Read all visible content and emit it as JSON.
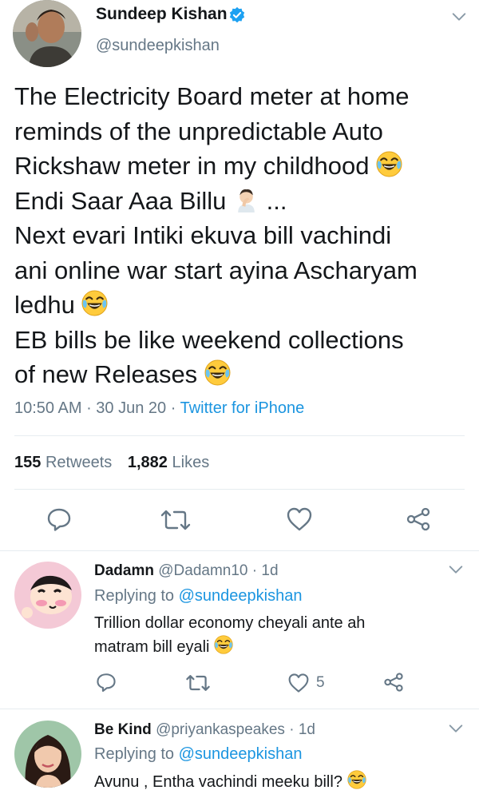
{
  "tweet": {
    "author_name": "Sundeep Kishan",
    "handle": "@sundeepkishan",
    "lines": [
      "The Electricity Board meter at home",
      "reminds of the unpredictable Auto",
      "Rickshaw meter in my childhood",
      "Endi Saar Aaa Billu",
      "...",
      "Next evari Intiki ekuva bill vachindi",
      "ani online war start ayina Ascharyam",
      "ledhu",
      "EB bills be like weekend collections",
      "of new Releases"
    ],
    "time": "10:50 AM",
    "dot1": " · ",
    "date": "30 Jun 20",
    "dot2": " · ",
    "source": "Twitter for iPhone",
    "retweets_count": "155",
    "retweets_label": "Retweets",
    "likes_count": "1,882",
    "likes_label": "Likes"
  },
  "replies": [
    {
      "name": "Dadamn",
      "handle": "@Dadamn10",
      "dot": " · ",
      "age": "1d",
      "replying_prefix": "Replying to ",
      "replying_handle": "@sundeepkishan",
      "line1": "Trillion dollar economy cheyali ante ah",
      "line2": "matram bill eyali",
      "like_count": "5"
    },
    {
      "name": "Be Kind",
      "handle": "@priyankaspeakes",
      "dot": " · ",
      "age": "1d",
      "replying_prefix": "Replying to ",
      "replying_handle": "@sundeepkishan",
      "line1": "Avunu , Entha vachindi meeku bill?"
    }
  ],
  "icons": {
    "verified": "verified-badge-icon",
    "reply": "reply-icon",
    "retweet": "retweet-icon",
    "like": "heart-icon",
    "share": "share-icon",
    "chevron": "chevron-down-icon",
    "laugh": "face-with-tears-of-joy-icon",
    "facepalm": "man-facepalming-icon"
  },
  "colors": {
    "link_blue": "#1b95e0",
    "verified_blue": "#1da1f2",
    "text": "#14171a",
    "secondary": "#657786",
    "divider": "#e6ecf0"
  }
}
